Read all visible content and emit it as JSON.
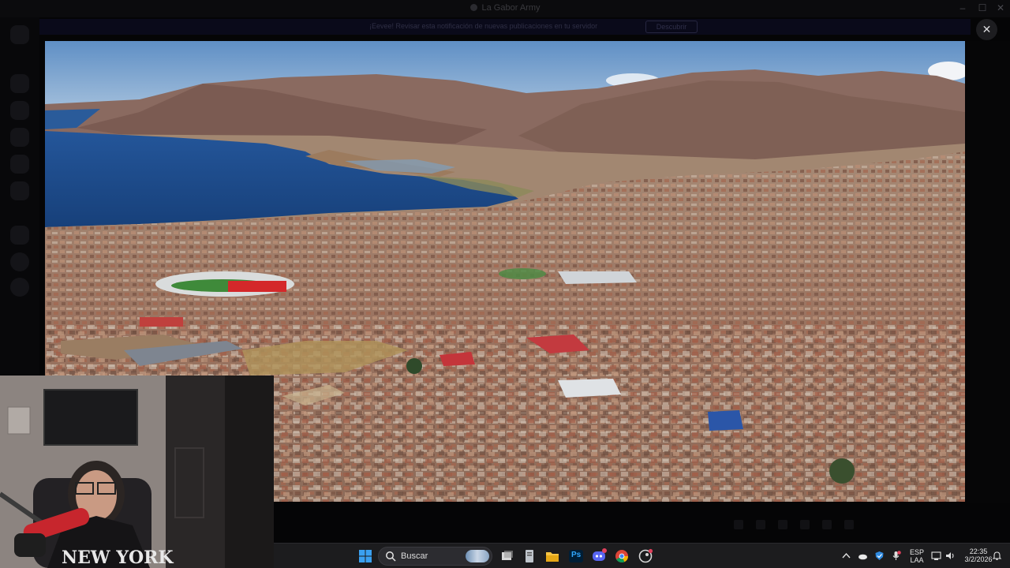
{
  "background_app": {
    "title": "La Gabor Army",
    "banner_text": "¡Eevee! Revisar esta notificación de nuevas publicaciones en tu servidor",
    "banner_button": "Descubrir"
  },
  "viewer": {
    "close_label": "✕",
    "image_subject": "aerial-city-by-lake-photo"
  },
  "taskbar": {
    "search_placeholder": "Buscar",
    "apps": [
      "windows-start",
      "task-view",
      "notepad",
      "file-explorer",
      "photoshop",
      "discord",
      "chrome",
      "steam"
    ],
    "ps_label": "Ps",
    "language": "ESP",
    "language_sub": "LAA",
    "time": "22:35",
    "date": "3/2/2026"
  },
  "colors": {
    "taskbar_bg": "#1c1c1e",
    "lake": "#1d4c8e",
    "sky": "#7fa6cf"
  }
}
